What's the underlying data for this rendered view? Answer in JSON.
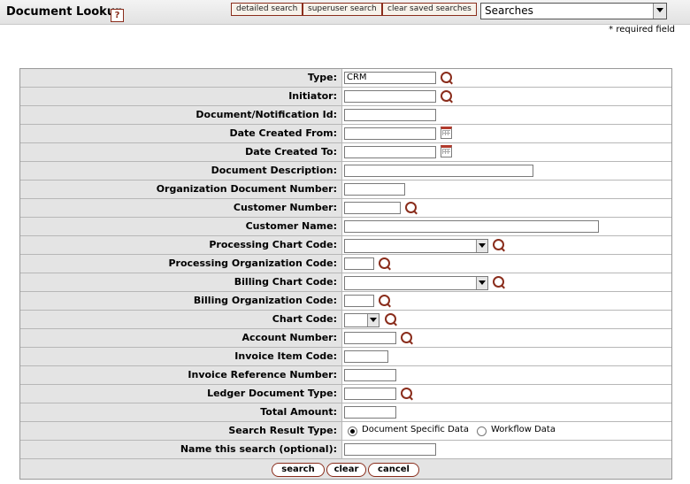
{
  "header": {
    "title": "Document Lookup",
    "help_glyph": "?",
    "buttons": [
      "detailed search",
      "superuser search",
      "clear saved searches"
    ],
    "saved_searches_value": "Searches"
  },
  "required_note": "* required field",
  "form": {
    "rows": [
      {
        "label": "Type:",
        "value": "CRM"
      },
      {
        "label": "Initiator:"
      },
      {
        "label": "Document/Notification Id:"
      },
      {
        "label": "Date Created From:"
      },
      {
        "label": "Date Created To:"
      },
      {
        "label": "Document Description:"
      },
      {
        "label": "Organization Document Number:"
      },
      {
        "label": "Customer Number:"
      },
      {
        "label": "Customer Name:"
      },
      {
        "label": "Processing Chart Code:"
      },
      {
        "label": "Processing Organization Code:"
      },
      {
        "label": "Billing Chart Code:"
      },
      {
        "label": "Billing Organization Code:"
      },
      {
        "label": "Chart Code:"
      },
      {
        "label": "Account Number:"
      },
      {
        "label": "Invoice Item Code:"
      },
      {
        "label": "Invoice Reference Number:"
      },
      {
        "label": "Ledger Document Type:"
      },
      {
        "label": "Total Amount:"
      },
      {
        "label": "Search Result Type:"
      },
      {
        "label": "Name this search (optional):"
      }
    ],
    "search_result_options": [
      "Document Specific Data",
      "Workflow Data"
    ],
    "search_result_selected": "Document Specific Data"
  },
  "actions": {
    "search": "search",
    "clear": "clear",
    "cancel": "cancel"
  },
  "colors": {
    "accent": "#8a2d1c",
    "label_bg": "#e4e4e4",
    "header_bg": "#e8e8e8"
  }
}
